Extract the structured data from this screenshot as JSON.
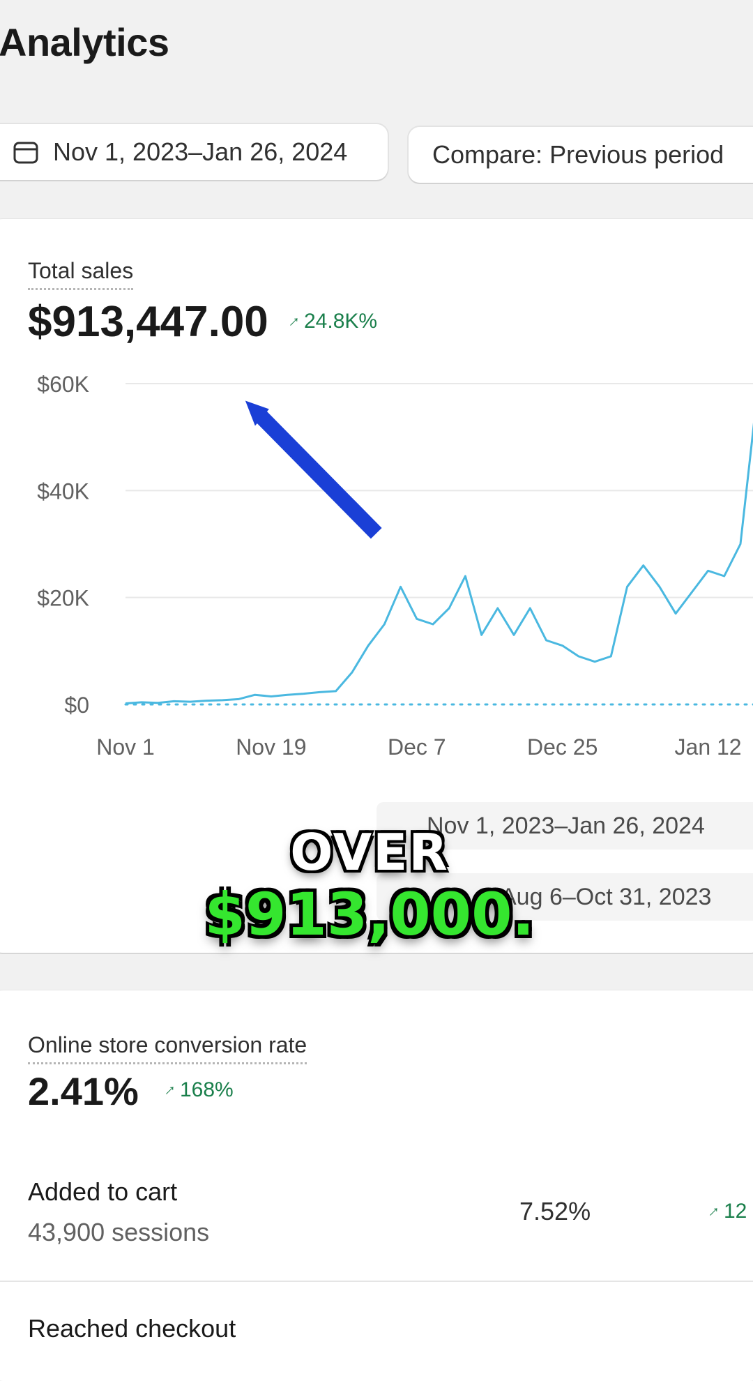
{
  "page": {
    "title": "Analytics"
  },
  "toolbar": {
    "date_range": "Nov 1, 2023–Jan 26, 2024",
    "compare": "Compare: Previous period"
  },
  "total_sales": {
    "label": "Total sales",
    "value": "$913,447.00",
    "delta": "24.8K%",
    "legend_current": "Nov 1, 2023–Jan 26, 2024",
    "legend_previous": "Aug 6–Oct 31, 2023"
  },
  "chart_data": {
    "type": "line",
    "title": "",
    "x_ticks": [
      "Nov 1",
      "Nov 19",
      "Dec 7",
      "Dec 25",
      "Jan 12"
    ],
    "y_ticks": [
      "$60K",
      "$40K",
      "$20K",
      "$0"
    ],
    "ylim": [
      0,
      60000
    ],
    "xlim_days": [
      0,
      81
    ],
    "grid": true,
    "series": [
      {
        "name": "Nov 1, 2023–Jan 26, 2024",
        "x": [
          0,
          2,
          4,
          6,
          8,
          10,
          12,
          14,
          16,
          18,
          20,
          22,
          24,
          26,
          28,
          30,
          32,
          34,
          36,
          38,
          40,
          42,
          44,
          46,
          48,
          50,
          52,
          54,
          56,
          58,
          60,
          62,
          64,
          66,
          68,
          70,
          72,
          74,
          76,
          78,
          79,
          80,
          81
        ],
        "y": [
          200,
          400,
          300,
          600,
          500,
          700,
          800,
          1000,
          1800,
          1500,
          1800,
          2000,
          2300,
          2500,
          6000,
          11000,
          15000,
          22000,
          16000,
          15000,
          18000,
          24000,
          13000,
          18000,
          13000,
          18000,
          12000,
          11000,
          9000,
          8000,
          9000,
          22000,
          26000,
          22000,
          17000,
          21000,
          25000,
          24000,
          30000,
          57000,
          55000,
          53000,
          52000
        ],
        "color": "#4ab8e0"
      },
      {
        "name": "Aug 6–Oct 31, 2023",
        "x": [
          0,
          81
        ],
        "y": [
          0,
          0
        ],
        "style": "dotted",
        "color": "#4ab8e0"
      }
    ],
    "annotation": "blue arrow pointing toward the top of the chart"
  },
  "overlay_caption": {
    "line1": "OVER",
    "line2": "$913,000."
  },
  "conversion": {
    "label": "Online store conversion rate",
    "value": "2.41%",
    "delta": "168%",
    "funnel": [
      {
        "name": "Added to cart",
        "sessions": "43,900 sessions",
        "pct": "7.52%",
        "delta": "12"
      },
      {
        "name": "Reached checkout",
        "sessions": "",
        "pct": "",
        "delta": ""
      }
    ]
  },
  "colors": {
    "accent_green": "#1a7f4b",
    "line": "#4ab8e0",
    "arrow": "#1a3fd6",
    "caption_green": "#35e62f"
  }
}
